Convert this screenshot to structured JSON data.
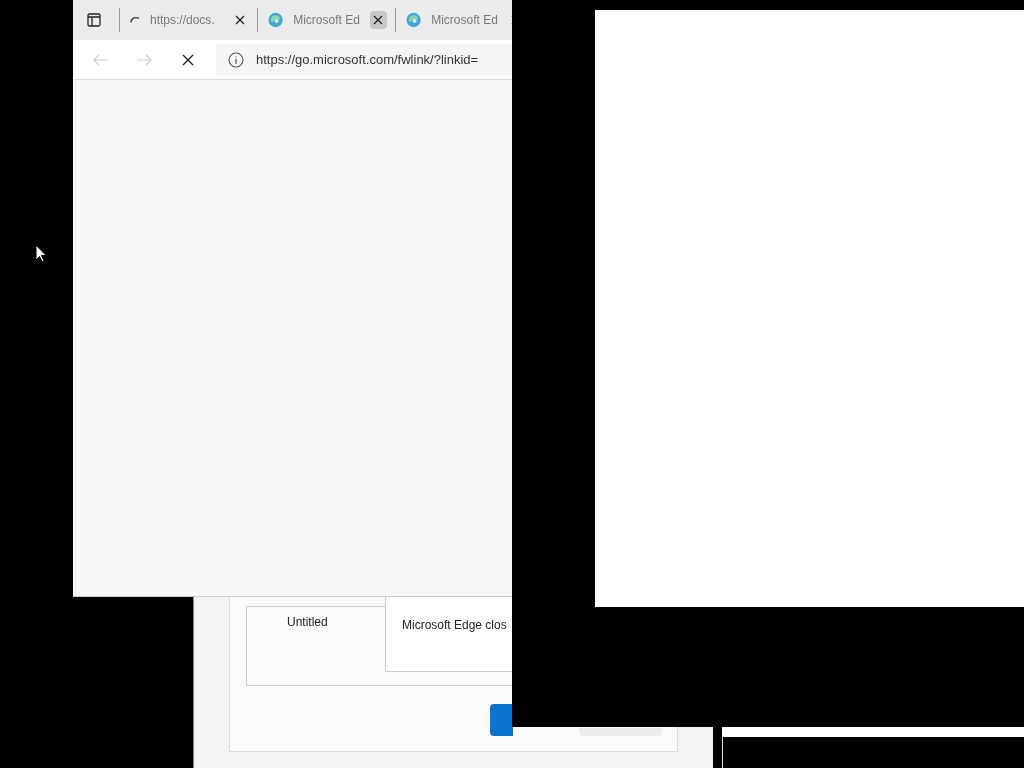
{
  "browser": {
    "tabs": [
      {
        "kind": "loading",
        "title": "https://docs.",
        "close_hovered": false
      },
      {
        "kind": "edge",
        "title": "Microsoft Ed",
        "close_hovered": true
      },
      {
        "kind": "edge",
        "title": "Microsoft Ed",
        "close_hovered": false
      }
    ],
    "address": "https://go.microsoft.com/fwlink/?linkid="
  },
  "dialog": {
    "item_title": "Untitled",
    "message": "Microsoft Edge clos"
  }
}
